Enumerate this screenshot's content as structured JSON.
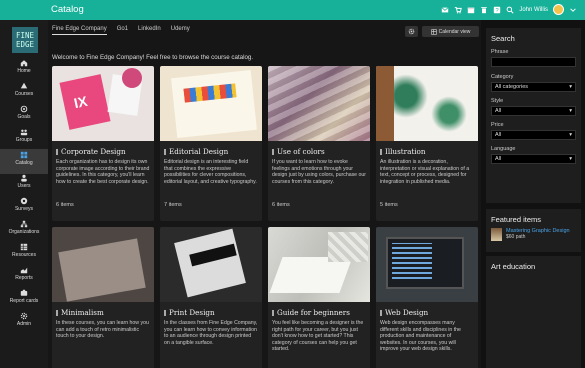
{
  "app": {
    "title": "Catalog",
    "user_name": "John Willis"
  },
  "logo_text": [
    "FINE",
    "EDGE"
  ],
  "sidebar": {
    "items": [
      {
        "label": "Home",
        "icon": "home-icon"
      },
      {
        "label": "Courses",
        "icon": "courses-icon"
      },
      {
        "label": "Goals",
        "icon": "goals-icon"
      },
      {
        "label": "Groups",
        "icon": "groups-icon"
      },
      {
        "label": "Catalog",
        "icon": "catalog-icon"
      },
      {
        "label": "Users",
        "icon": "users-icon"
      },
      {
        "label": "Surveys",
        "icon": "surveys-icon"
      },
      {
        "label": "Organizations",
        "icon": "organizations-icon"
      },
      {
        "label": "Resources",
        "icon": "resources-icon"
      },
      {
        "label": "Reports",
        "icon": "reports-icon"
      },
      {
        "label": "Report cards",
        "icon": "report-cards-icon"
      },
      {
        "label": "Admin",
        "icon": "admin-icon"
      }
    ]
  },
  "tabs": [
    "Fine Edge Company",
    "Go1",
    "LinkedIn",
    "Udemy"
  ],
  "calendar_label": "Calendar view",
  "welcome": "Welcome to Fine Edge Company! Feel free to browse the course catalog.",
  "cards": [
    {
      "title": "Corporate Design",
      "desc": "Each organization has to design its own corporate image according to their brand guidelines. In this category, you'll learn how to create the best corporate design.",
      "count": "6 items"
    },
    {
      "title": "Editorial Design",
      "desc": "Editorial design is an interesting field that combines the expressive possibilities for clever compositions, editorial layout, and creative typography.",
      "count": "7 items"
    },
    {
      "title": "Use of colors",
      "desc": "If you want to learn how to evoke feelings and emotions through your design just by using colors, purchase our courses from this category.",
      "count": "6 items"
    },
    {
      "title": "Illustration",
      "desc": "An illustration is a decoration, interpretation or visual explanation of a text, concept or process, designed for integration in published media.",
      "count": "5 items"
    },
    {
      "title": "Minimalism",
      "desc": "In these courses, you can learn how you can add a touch of retro minimalistic touch to your design.",
      "count": ""
    },
    {
      "title": "Print Design",
      "desc": "In the classes from Fine Edge Company, you can learn how to convey information to an audience through design printed on a tangible surface.",
      "count": ""
    },
    {
      "title": "Guide for beginners",
      "desc": "You feel like becoming a designer is the right path for your career, but you just don't know how to get started? This category of courses can help you get started.",
      "count": ""
    },
    {
      "title": "Web Design",
      "desc": "Web design encompasses many different skills and disciplines in the production and maintenance of websites. In our courses, you will improve your web design skills.",
      "count": ""
    }
  ],
  "search_panel": {
    "title": "Search",
    "phrase_label": "Phrase",
    "phrase_value": "",
    "category_label": "Category",
    "category_value": "All categories",
    "style_label": "Style",
    "style_value": "All",
    "price_label": "Price",
    "price_value": "All",
    "language_label": "Language",
    "language_value": "All"
  },
  "featured": {
    "title": "Featured items",
    "item_name": "Mastering Graphic Design",
    "item_price": "$60 path"
  },
  "art_education": {
    "title": "Art education"
  },
  "colors": {
    "accent": "#17b19a",
    "link": "#4aa3e6"
  }
}
